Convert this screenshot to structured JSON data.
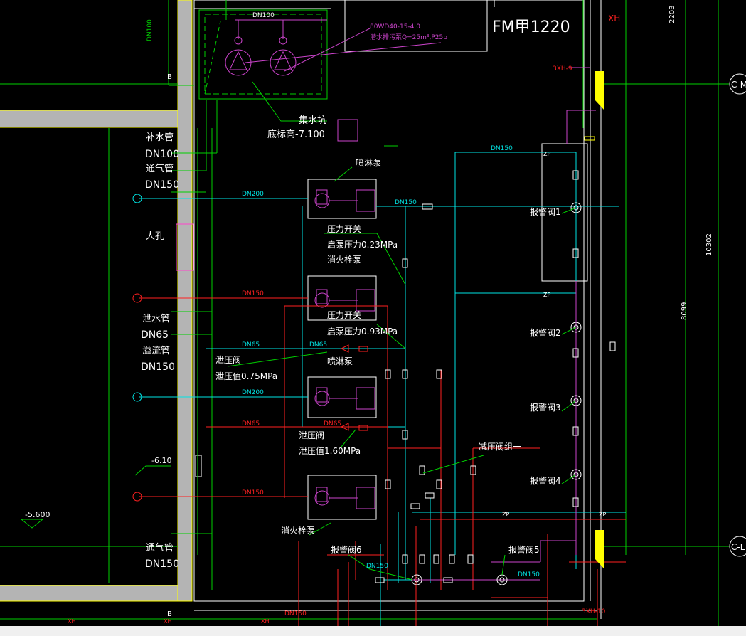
{
  "drawing": {
    "title": "FM甲1220",
    "equipment_note": [
      "80WD40-15-4.0",
      "潜水排污泵Q=25m³,P25b"
    ],
    "sump_top": "DN100",
    "sump": [
      "集水坑",
      "底标高-7.100"
    ],
    "inlet_labels": [
      "补水管",
      "DN100",
      "通气管",
      "DN150",
      "人孔",
      "泄水管",
      "DN65",
      "溢流管",
      "DN150",
      "通气管",
      "DN150"
    ],
    "pumps": [
      "喷淋泵",
      "消火栓泵",
      "喷淋泵",
      "消火栓泵"
    ],
    "pressure_switches": [
      "压力开关",
      "启泵压力0.23MPa",
      "压力开关",
      "启泵压力0.93MPa"
    ],
    "relief_valves": [
      "泄压阀",
      "泄压值0.75MPa",
      "泄压阀",
      "泄压值1.60MPa"
    ],
    "pipe_sizes": [
      "DN200",
      "DN150",
      "DN150",
      "DN65",
      "DN65",
      "DN65",
      "DN200",
      "DN65",
      "DN150",
      "DN150",
      "DN150",
      "DN150",
      "DN150",
      "DN100"
    ],
    "alarm_valves": [
      "报警阀1",
      "报警阀2",
      "报警阀3",
      "报警阀4",
      "报警阀5",
      "报警阀6"
    ],
    "reducing_group": "减压阀组一",
    "levels": [
      "-6.10",
      "-5.600"
    ],
    "grid": [
      "C-M",
      "C-L",
      "B",
      "B"
    ],
    "dims": [
      "2203",
      "10302",
      "8099"
    ],
    "axis_tags": [
      "3XH-9",
      "3XH-10",
      "XH",
      "XH",
      "XH",
      "XH"
    ],
    "zp": [
      "ZP",
      "ZP",
      "ZP",
      "ZP"
    ]
  },
  "colors": {
    "background": "#000000",
    "wall": "#b4b4b4",
    "cyan": "#00e5e5",
    "red": "#ff2020",
    "green": "#00d000",
    "magenta": "#cc44cc",
    "yellow": "#ffff00",
    "white": "#ffffff"
  }
}
